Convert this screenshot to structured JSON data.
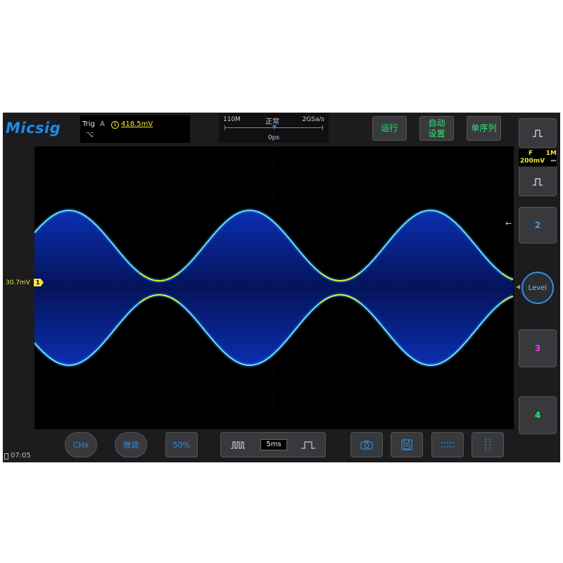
{
  "brand": "Micsig",
  "trigger": {
    "label": "Trig",
    "source": "A",
    "channel": "1",
    "level": "418.5mV",
    "edge_symbol": "⌥"
  },
  "acquisition": {
    "memory_depth": "110M",
    "mode": "正常",
    "sample_rate": "2GSa/s",
    "delay": "0ps"
  },
  "top_buttons": {
    "run": "运行",
    "auto_set_line1": "自动",
    "auto_set_line2": "设置",
    "single": "单序列"
  },
  "waveform": {
    "ch1_offset_label": "30.7mV",
    "ch1_marker": "1",
    "trigger_position_marker": "T",
    "envelope_periods_visible": 2.65,
    "colors": {
      "trace_blue": "#1e8be6",
      "ch1_yellow": "#f3e53a",
      "ch2_blue": "#3a9ff0",
      "ch3_magenta": "#e040e0",
      "ch4_green": "#2ee86a"
    }
  },
  "right_panel": {
    "ch1_coupling": "F",
    "ch1_impedance": "1M",
    "ch1_scale": "200mV",
    "ch1_dc_symbol": "⎓",
    "ch2_label": "2",
    "level_label": "Level",
    "ch3_label": "3",
    "ch4_label": "4",
    "pulse_icon": "pulse-icon"
  },
  "bottom_bar": {
    "chx": "CHx",
    "fine": "微调",
    "fifty_percent": "50%",
    "timebase": "5ms"
  },
  "status": {
    "time": "07:05"
  }
}
